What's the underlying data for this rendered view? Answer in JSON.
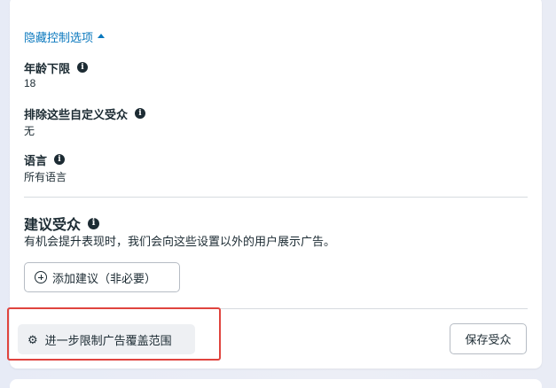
{
  "controls": {
    "toggle_label": "隐藏控制选项"
  },
  "fields": [
    {
      "label": "年龄下限",
      "value": "18"
    },
    {
      "label": "排除这些自定义受众",
      "value": "无"
    },
    {
      "label": "语言",
      "value": "所有语言"
    }
  ],
  "suggested_audience": {
    "title": "建议受众",
    "description": "有机会提升表现时，我们会向这些设置以外的用户展示广告。",
    "add_button_label": "添加建议（非必要）"
  },
  "footer": {
    "restrict_button_label": "进一步限制广告覆盖范围",
    "save_button_label": "保存受众"
  },
  "colors": {
    "link": "#0a78be",
    "highlight": "#e0443e",
    "text": "#1c2b33"
  }
}
